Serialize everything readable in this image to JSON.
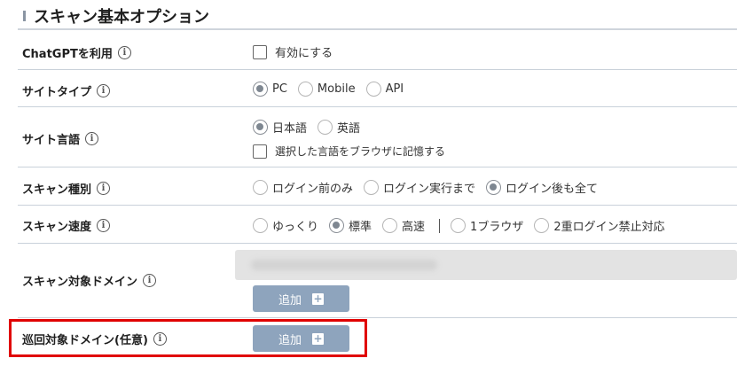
{
  "section": {
    "title": "スキャン基本オプション"
  },
  "info_glyph": "i",
  "rows": {
    "chatgpt": {
      "label": "ChatGPTを利用",
      "checkbox_label": "有効にする"
    },
    "site_type": {
      "label": "サイトタイプ",
      "options": [
        "PC",
        "Mobile",
        "API"
      ],
      "selected": "PC"
    },
    "site_language": {
      "label": "サイト言語",
      "options": [
        "日本語",
        "英語"
      ],
      "selected": "日本語",
      "checkbox_label": "選択した言語をブラウザに記憶する"
    },
    "scan_type": {
      "label": "スキャン種別",
      "options": [
        "ログイン前のみ",
        "ログイン実行まで",
        "ログイン後も全て"
      ],
      "selected": "ログイン後も全て"
    },
    "scan_speed": {
      "label": "スキャン速度",
      "options": [
        "ゆっくり",
        "標準",
        "高速",
        "1ブラウザ",
        "2重ログイン禁止対応"
      ],
      "selected": "標準"
    },
    "scan_domain": {
      "label": "スキャン対象ドメイン",
      "add_label": "追加"
    },
    "crawl_domain": {
      "label": "巡回対象ドメイン(任意)",
      "add_label": "追加"
    }
  },
  "plus_glyph": "+",
  "colors": {
    "highlight": "#e00000",
    "button": "#8ea4bd"
  }
}
